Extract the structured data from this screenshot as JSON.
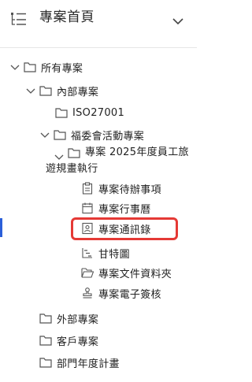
{
  "header": {
    "title": "專案首頁"
  },
  "tree": {
    "root": "所有專案",
    "internal": "內部專案",
    "iso": "ISO27001",
    "welfare": "福委會活動專案",
    "project_line1": "專案 2025年度員工旅",
    "project_line2": "遊規畫執行",
    "children": {
      "todo": "專案待辦事項",
      "calendar": "專案行事曆",
      "contacts": "專案通訊錄",
      "gantt": "甘特圖",
      "docs": "專案文件資料夾",
      "sign": "專案電子簽核"
    },
    "external": "外部專案",
    "customer": "客戶專案",
    "department": "部門年度計畫"
  },
  "colors": {
    "active_bar": "#2b5fd9",
    "highlight": "#e53935"
  }
}
